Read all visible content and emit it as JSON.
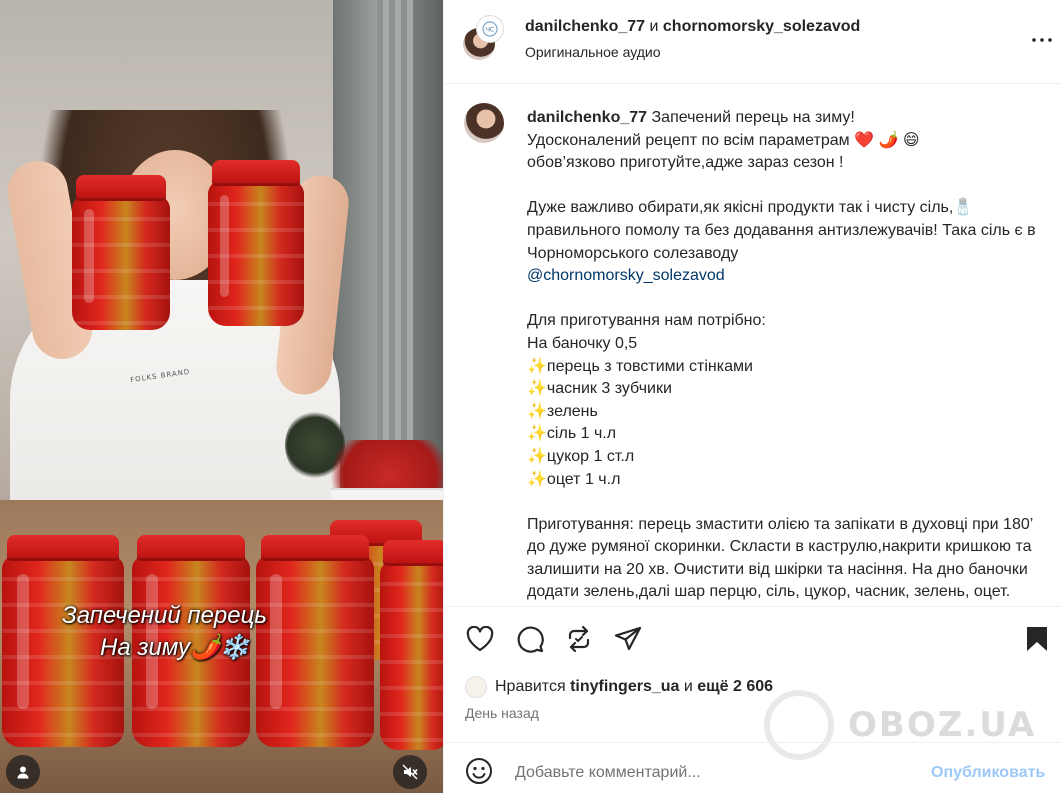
{
  "post": {
    "author": "danilchenko_77",
    "and": "и",
    "collaborator": "chornomorsky_solezavod",
    "audio": "Оригинальное аудио"
  },
  "video": {
    "overlay_line1": "Запечений перець",
    "overlay_line2": "На зиму🌶️❄️",
    "shirt_text": "FOLKS BRAND"
  },
  "caption": {
    "user": "danilchenko_77",
    "lines": [
      "Запечений перець на зиму!",
      "Удосконалений рецепт по всім параметрам ❤️ 🌶️ 😄",
      "обов’язково приготуйте,адже зараз сезон !"
    ],
    "para2": "Дуже важливо обирати,як якісні продукти так і чисту сіль,🧂 правильного помолу та без додавання антизлежувачів! Така сіль є в Чорноморського солезаводу",
    "mention": "@chornomorsky_solezavod",
    "ingredients_title": "Для приготування нам потрібно:",
    "portion": "На баночку 0,5",
    "ingredients": [
      "✨перець з товстими стінками",
      "✨часник 3 зубчики",
      "✨зелень",
      "✨сіль 1 ч.л",
      "✨цукор 1 ст.л",
      "✨оцет 1 ч.л"
    ],
    "method": "Приготування: перець змастити олією та запікати в духовці при 180’ до дуже румяної скоринки. Скласти в каструлю,накрити кришкою та залишити на 20 хв. Очистити від шкірки та насіння. На дно баночки додати зелень,далі шар перцю, сіль, цукор, часник, зелень, оцет."
  },
  "likes": {
    "prefix": "Нравится",
    "user": "tinyfingers_ua",
    "middle": "и",
    "count": "ещё 2 606"
  },
  "time_ago": "День назад",
  "comment": {
    "placeholder": "Добавьте комментарий...",
    "post_label": "Опубликовать"
  },
  "watermark": "OBOZ.UA",
  "icons": {
    "like": "heart-icon",
    "comment": "comment-icon",
    "repost": "repost-icon",
    "share": "share-icon",
    "save": "bookmark-icon",
    "more": "more-icon",
    "emoji": "emoji-icon",
    "mute": "mute-icon",
    "user": "user-icon"
  }
}
